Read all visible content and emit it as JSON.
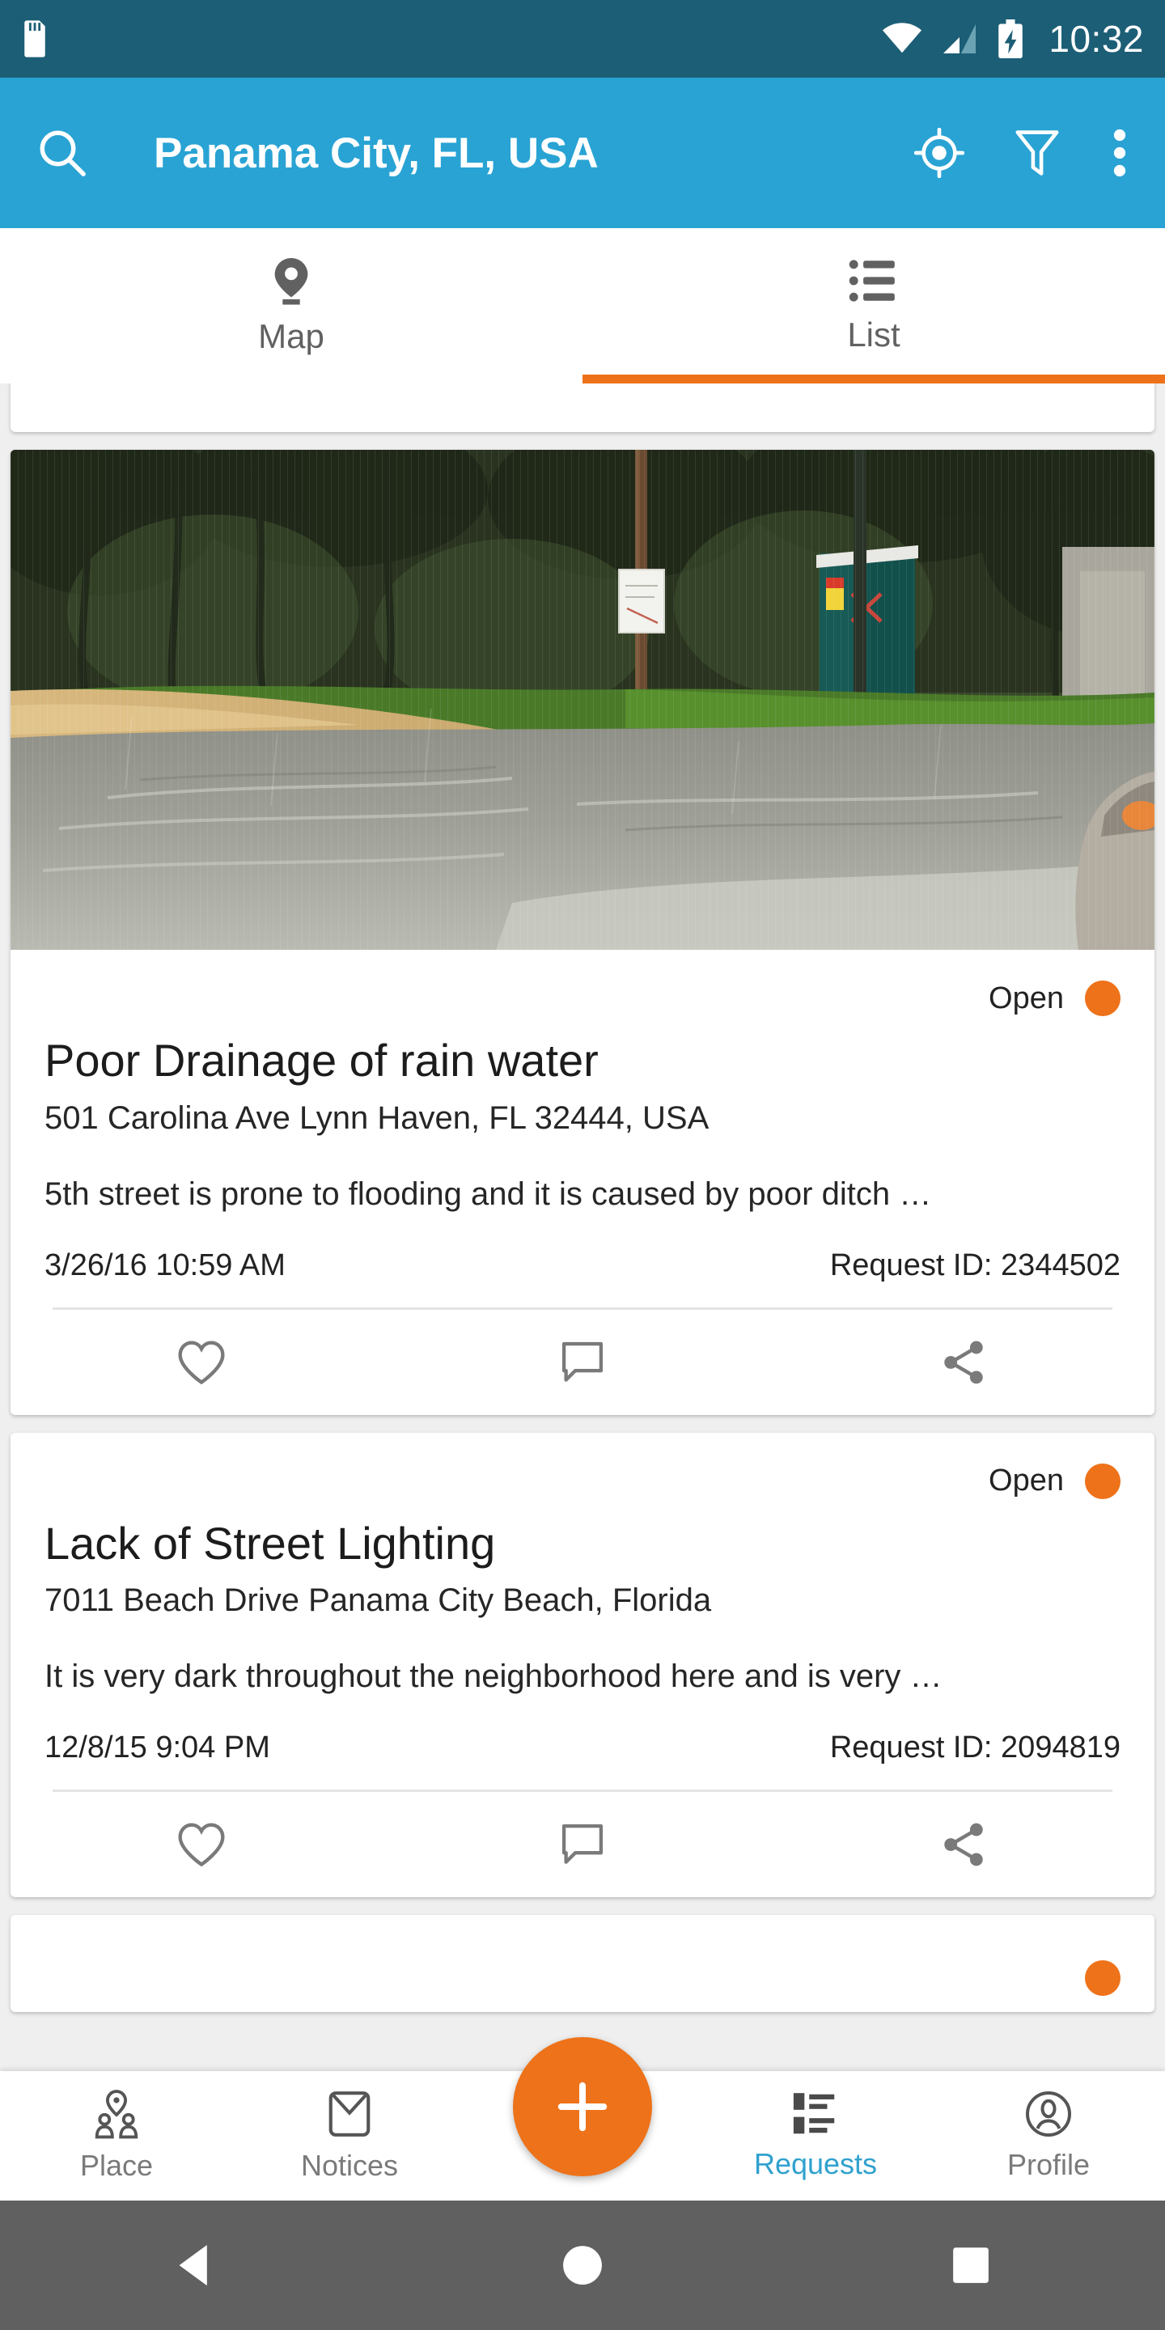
{
  "status_bar": {
    "time": "10:32",
    "icons": [
      "sd-card-icon",
      "wifi-icon",
      "cellular-signal-icon",
      "battery-charging-icon"
    ]
  },
  "app_bar": {
    "title": "Panama City, FL, USA",
    "search_icon": "search-icon",
    "my_location_icon": "my-location-icon",
    "filter_icon": "filter-icon",
    "overflow_icon": "overflow-menu-icon",
    "background_color": "#29a3d4"
  },
  "tabs": {
    "items": [
      {
        "label": "Map",
        "icon": "map-pin-icon",
        "active": false
      },
      {
        "label": "List",
        "icon": "list-icon",
        "active": true
      }
    ],
    "indicator_color": "#ee7219"
  },
  "cards": [
    {
      "status_label": "Open",
      "status_color": "#ee7219",
      "title": "Poor Drainage of rain water",
      "address": "501 Carolina Ave Lynn Haven, FL 32444, USA",
      "description": "5th street is prone to flooding and it is caused by poor ditch …",
      "timestamp": "3/26/16 10:59 AM",
      "request_id": "Request ID: 2344502",
      "actions": [
        "heart-icon",
        "comment-icon",
        "share-icon"
      ],
      "photo_alt": "flooded street with trees and portable toilet"
    },
    {
      "status_label": "Open",
      "status_color": "#ee7219",
      "title": "Lack of Street Lighting",
      "address": "7011 Beach Drive Panama City Beach, Florida",
      "description": "It is very dark throughout the neighborhood here and is very …",
      "timestamp": "12/8/15 9:04 PM",
      "request_id": "Request ID: 2094819",
      "actions": [
        "heart-icon",
        "comment-icon",
        "share-icon"
      ]
    }
  ],
  "bottom_nav": {
    "items": [
      {
        "label": "Place",
        "icon": "place-people-icon",
        "active": false
      },
      {
        "label": "Notices",
        "icon": "envelope-icon",
        "active": false
      },
      {
        "label": "Requests",
        "icon": "requests-list-icon",
        "active": true
      },
      {
        "label": "Profile",
        "icon": "profile-person-icon",
        "active": false
      }
    ],
    "fab_icon": "plus-icon",
    "fab_color": "#ee7219",
    "active_color": "#30a1ce"
  },
  "android_nav": {
    "back": "back-triangle-icon",
    "home": "home-circle-icon",
    "recents": "recents-square-icon",
    "background_color": "#606060"
  }
}
